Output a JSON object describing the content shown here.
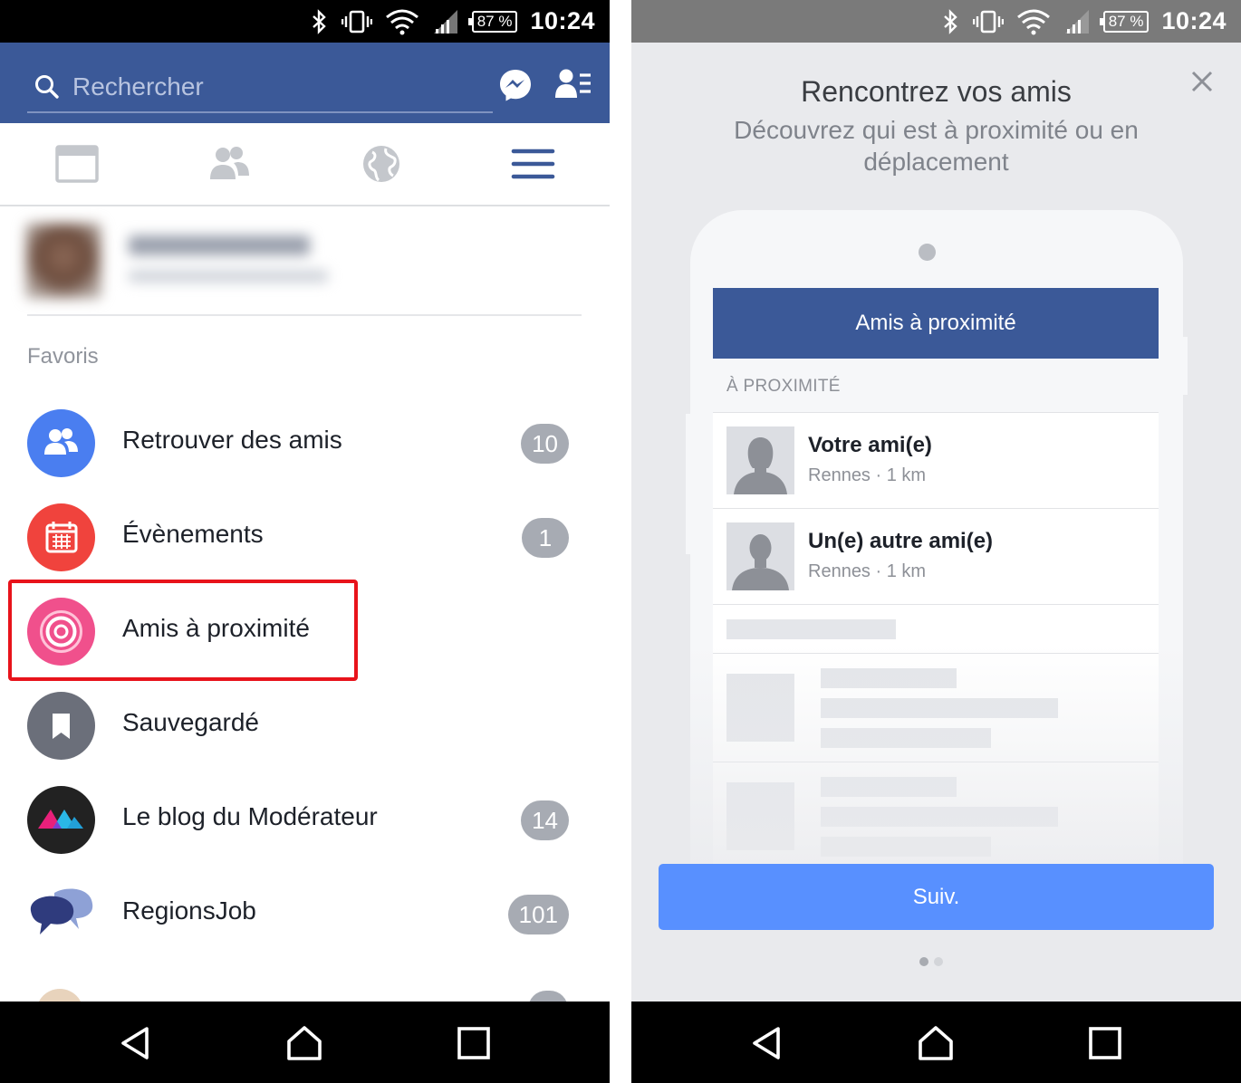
{
  "status_bar": {
    "battery": "87 %",
    "time": "10:24"
  },
  "left": {
    "search": {
      "placeholder": "Rechercher"
    },
    "favorites_title": "Favoris",
    "menu_items": [
      {
        "label": "Retrouver des amis",
        "badge": "10",
        "icon": "friends-icon",
        "color": "#4a7ef0"
      },
      {
        "label": "Évènements",
        "badge": "1",
        "icon": "calendar-icon",
        "color": "#f0433d"
      },
      {
        "label": "Amis à proximité",
        "badge": "",
        "icon": "nearby-icon",
        "color": "#f0508c"
      },
      {
        "label": "Sauvegardé",
        "badge": "",
        "icon": "bookmark-icon",
        "color": "#6b6f7a"
      },
      {
        "label": "Le blog du Modérateur",
        "badge": "14",
        "icon": "bdm-logo-icon",
        "color": "#222222"
      },
      {
        "label": "RegionsJob",
        "badge": "101",
        "icon": "regionsjob-logo-icon",
        "color": "#2f3b7d"
      }
    ]
  },
  "right": {
    "title": "Rencontrez vos amis",
    "subtitle": "Découvrez qui est à proximité ou en déplacement",
    "phone": {
      "header": "Amis à proximité",
      "section": "À PROXIMITÉ",
      "friends": [
        {
          "name": "Votre ami(e)",
          "location": "Rennes · 1 km"
        },
        {
          "name": "Un(e) autre ami(e)",
          "location": "Rennes · 1 km"
        }
      ]
    },
    "next_button": "Suiv.",
    "page_indicator": {
      "current": 1,
      "total": 2
    }
  },
  "colors": {
    "facebook_blue": "#3b5998",
    "button_blue": "#5890ff",
    "highlight_red": "#e8131b"
  }
}
